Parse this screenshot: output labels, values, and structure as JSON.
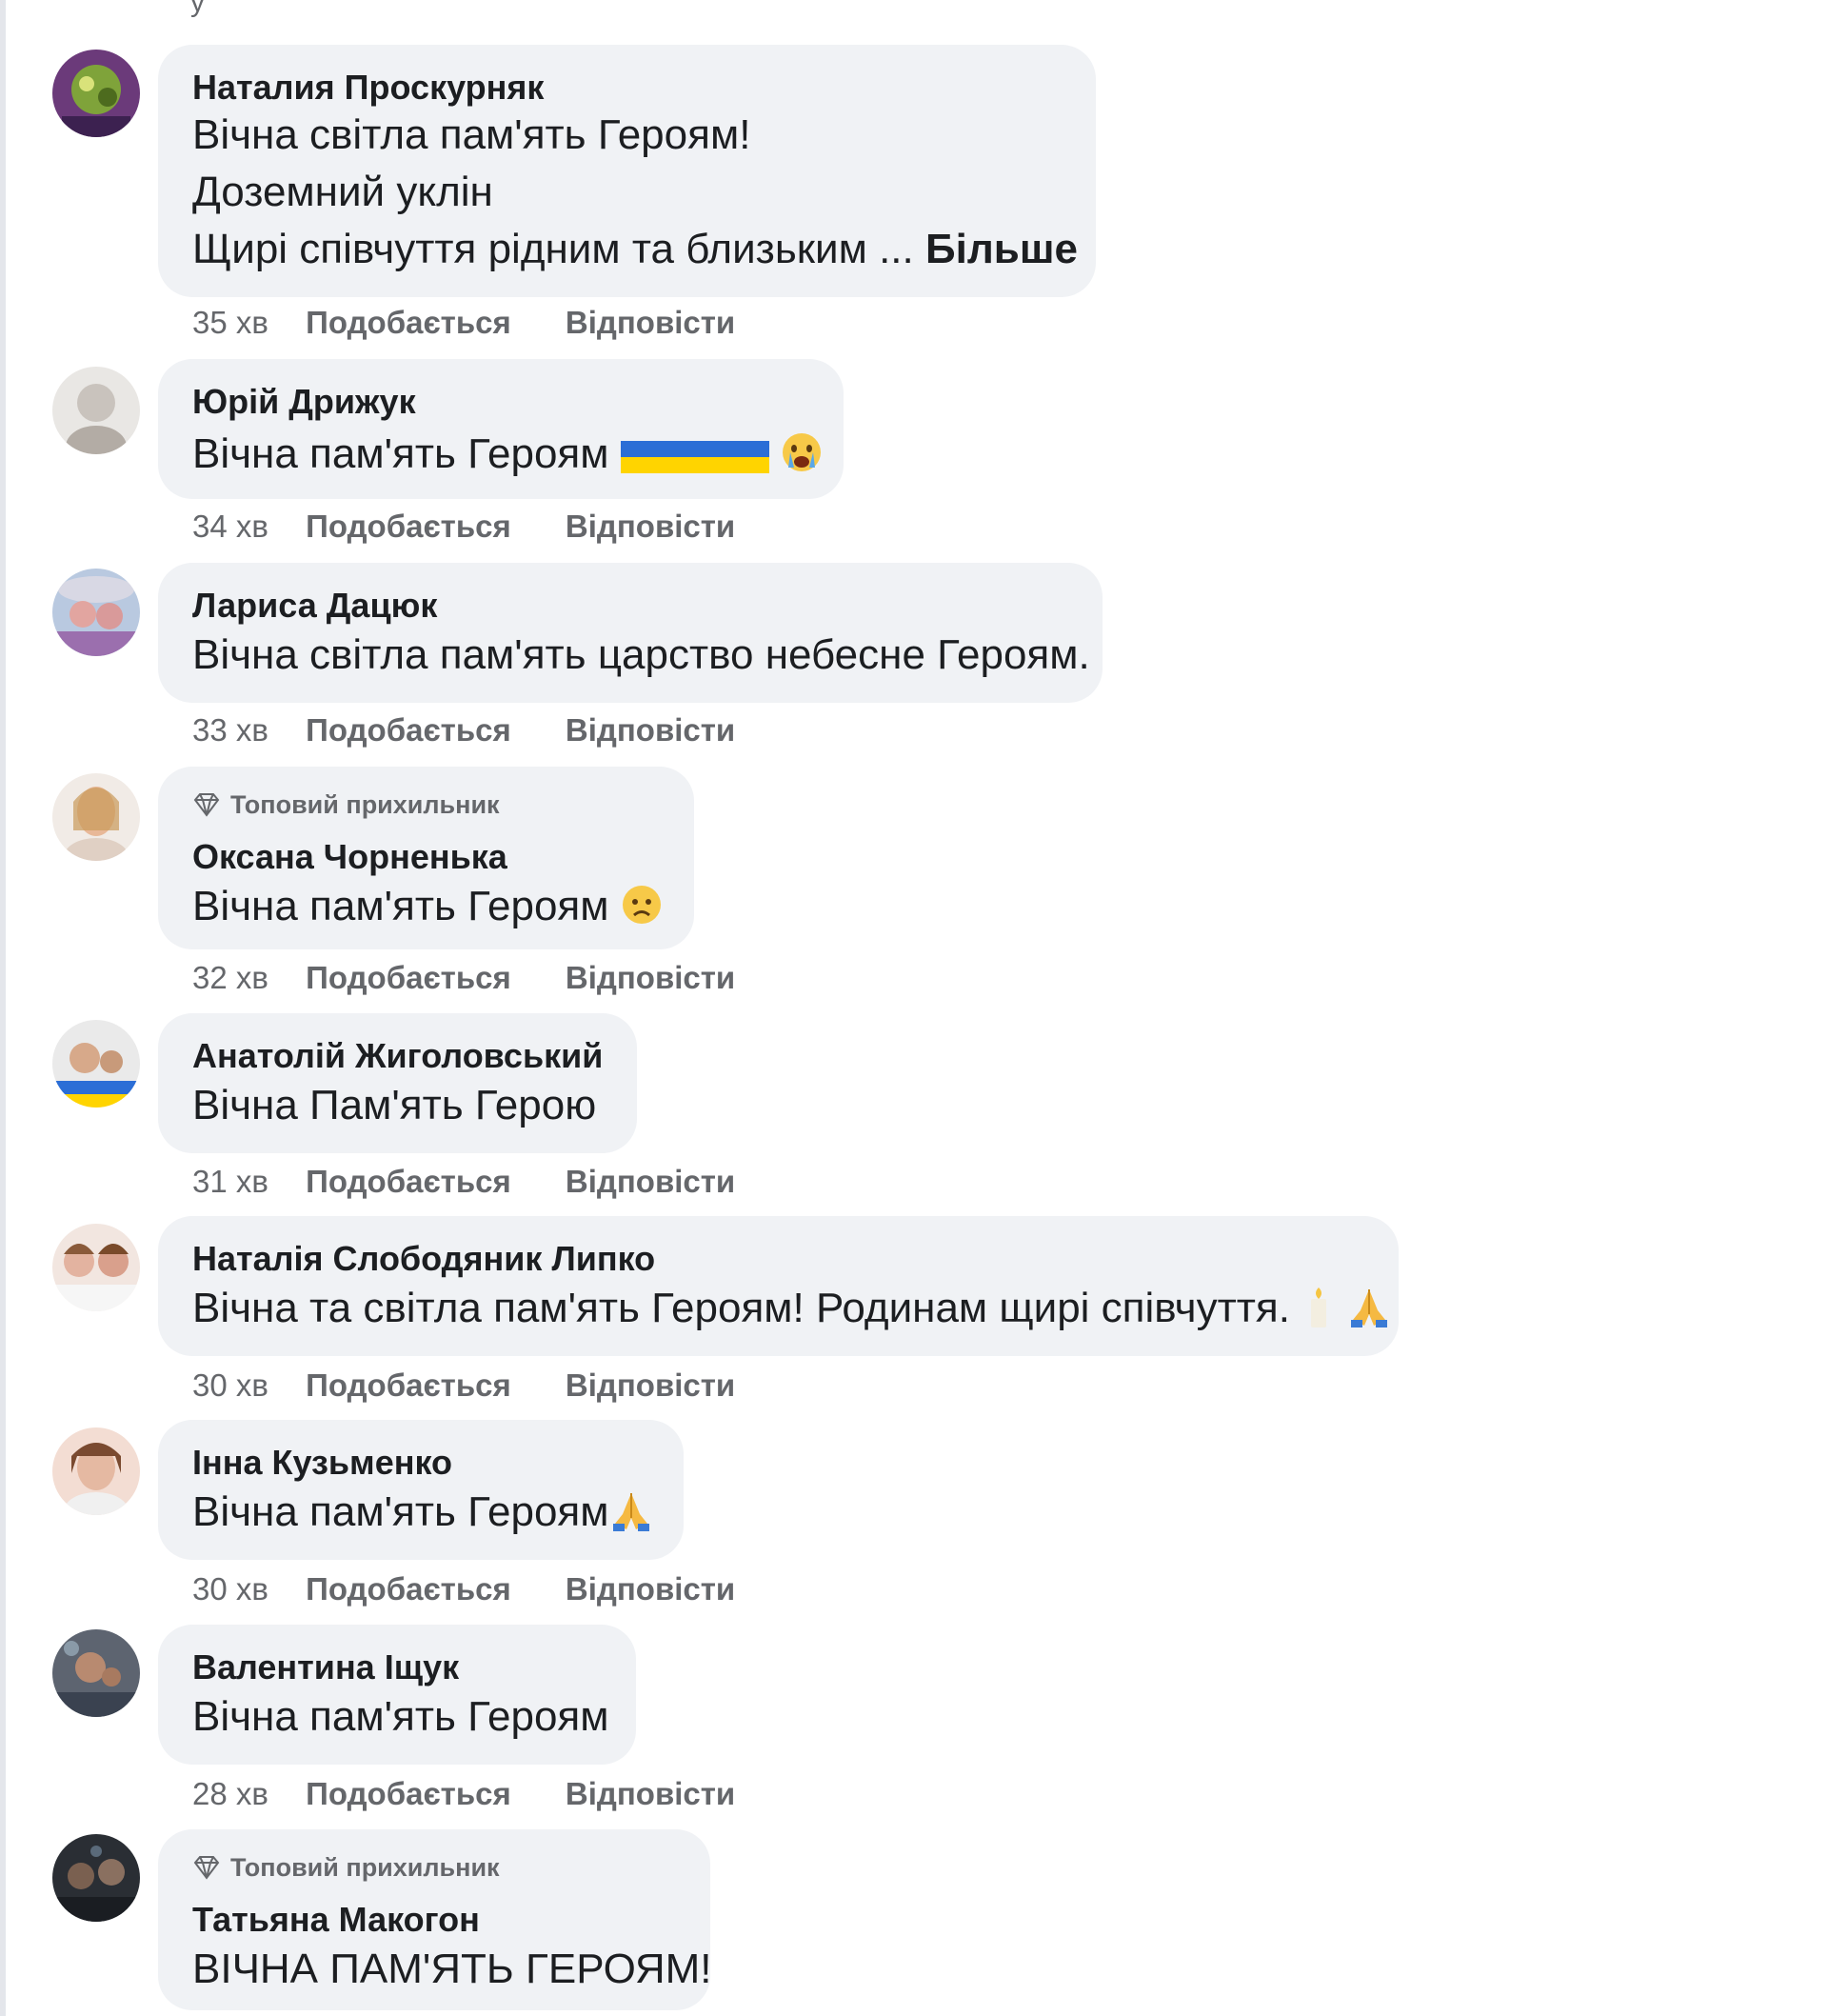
{
  "top_fragment": "у",
  "comments": [
    {
      "author": "Наталия Проскурняк",
      "badge": "",
      "lines": [
        "Вічна світла пам'ять Героям!",
        "Доземний уклін",
        "Щирі співчуття рідним та близьким ..."
      ],
      "more": "Більше",
      "time": "35 хв",
      "like": "Подобається",
      "reply": "Відповісти"
    },
    {
      "author": "Юрій Дрижук",
      "badge": "",
      "lines": [
        "Вічна пам'ять Героям"
      ],
      "emoji": [
        "ua-flag-icon",
        "ua-flag-icon",
        "ua-flag-icon",
        "crying-face-icon"
      ],
      "time": "34 хв",
      "like": "Подобається",
      "reply": "Відповісти"
    },
    {
      "author": "Лариса Дацюк",
      "badge": "",
      "lines": [
        "Вічна світла пам'ять царство небесне Героям."
      ],
      "time": "33 хв",
      "like": "Подобається",
      "reply": "Відповісти"
    },
    {
      "author": "Оксана Чорненька",
      "badge": "Топовий прихильник",
      "lines": [
        "Вічна пам'ять Героям"
      ],
      "emoji": [
        "sad-face-icon"
      ],
      "time": "32 хв",
      "like": "Подобається",
      "reply": "Відповісти"
    },
    {
      "author": "Анатолій Жиголовський",
      "badge": "",
      "lines": [
        "Вічна Пам'ять Герою"
      ],
      "time": "31 хв",
      "like": "Подобається",
      "reply": "Відповісти"
    },
    {
      "author": "Наталія Слободяник Липко",
      "badge": "",
      "lines": [
        "Вічна та світла пам'ять Героям! Родинам щирі співчуття."
      ],
      "emoji": [
        "candle-icon",
        "praying-hands-icon"
      ],
      "time": "30 хв",
      "like": "Подобається",
      "reply": "Відповісти"
    },
    {
      "author": "Інна Кузьменко",
      "badge": "",
      "lines": [
        "Вічна пам'ять Героям"
      ],
      "emoji": [
        "praying-hands-icon"
      ],
      "time": "30 хв",
      "like": "Подобається",
      "reply": "Відповісти"
    },
    {
      "author": "Валентина Іщук",
      "badge": "",
      "lines": [
        "Вічна пам'ять Героям"
      ],
      "time": "28 хв",
      "like": "Подобається",
      "reply": "Відповісти"
    },
    {
      "author": "Татьяна Макогон",
      "badge": "Топовий прихильник",
      "lines": [
        "ВІЧНА ПАМ'ЯТЬ ГЕРОЯМ!"
      ],
      "time": "",
      "like": "",
      "reply": ""
    }
  ],
  "colors": {
    "bubble": "#f0f2f5",
    "text": "#1c1e21",
    "meta": "#65676b"
  }
}
